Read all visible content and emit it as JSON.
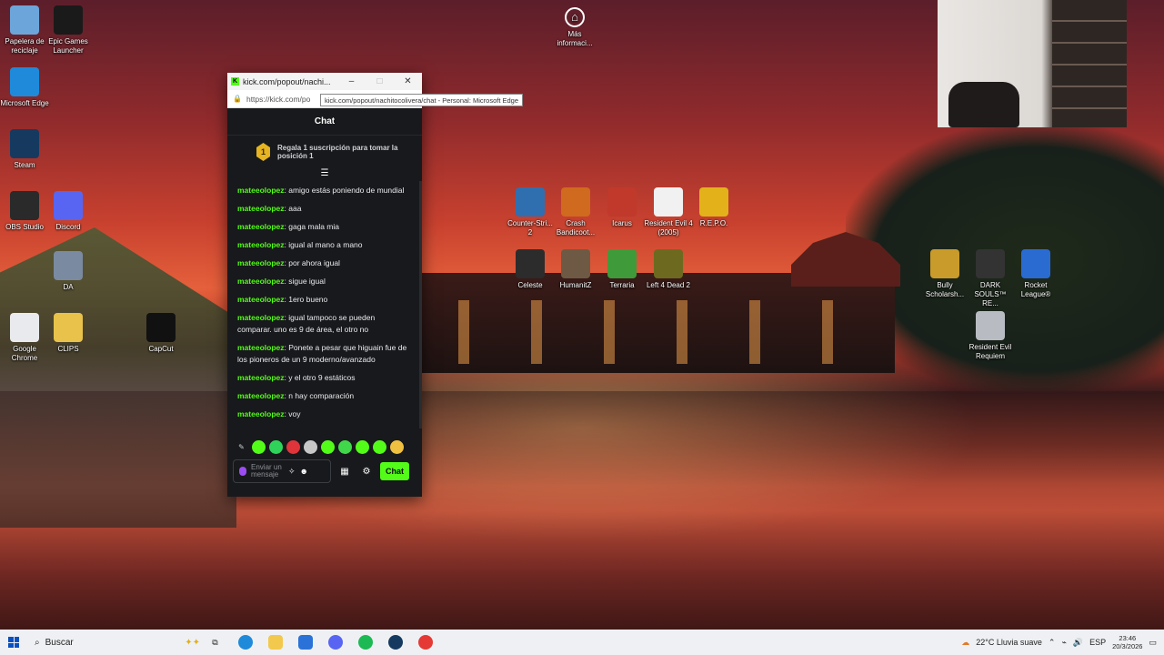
{
  "desktop": {
    "left_icons": [
      {
        "label": "Papelera de reciclaje",
        "icon": "recycle-bin-icon",
        "color": "#6ca5d9"
      },
      {
        "label": "Epic Games Launcher",
        "icon": "epic-games-icon",
        "color": "#1a1a1a"
      },
      {
        "label": "Microsoft Edge",
        "icon": "edge-icon",
        "color": "#1f8ad9"
      },
      {
        "label": "Steam",
        "icon": "steam-icon",
        "color": "#163a5f"
      },
      {
        "label": "OBS Studio",
        "icon": "obs-icon",
        "color": "#2a2a2a"
      },
      {
        "label": "Discord",
        "icon": "discord-icon",
        "color": "#5865f2"
      },
      {
        "label": "DA",
        "icon": "da-shortcut-icon",
        "color": "#7a8aa0"
      },
      {
        "label": "Google Chrome",
        "icon": "chrome-icon",
        "color": "#e8eaed"
      },
      {
        "label": "CLIPS",
        "icon": "folder-icon",
        "color": "#e8c24a"
      },
      {
        "label": "CapCut",
        "icon": "capcut-icon",
        "color": "#111111"
      }
    ],
    "info_icon": {
      "label": "Más informaci...",
      "icon": "info-camera-icon"
    },
    "game_icons": [
      {
        "label": "Counter-Stri... 2",
        "icon": "cs2-icon",
        "color": "#2f6fb0"
      },
      {
        "label": "Crash Bandicoot...",
        "icon": "crash-icon",
        "color": "#d06a1e"
      },
      {
        "label": "Icarus",
        "icon": "icarus-icon",
        "color": "#c0392b"
      },
      {
        "label": "Resident Evil 4 (2005)",
        "icon": "re4-icon",
        "color": "#f1f1f1"
      },
      {
        "label": "R.E.P.O.",
        "icon": "repo-icon",
        "color": "#e3b21a"
      },
      {
        "label": "Celeste",
        "icon": "celeste-icon",
        "color": "#2c2c2c"
      },
      {
        "label": "HumanitZ",
        "icon": "humanitz-icon",
        "color": "#6e5a44"
      },
      {
        "label": "Terraria",
        "icon": "terraria-icon",
        "color": "#3f9a3a"
      },
      {
        "label": "Left 4 Dead 2",
        "icon": "l4d2-icon",
        "color": "#6d6a1f"
      }
    ],
    "right_icons": [
      {
        "label": "Bully Scholarsh...",
        "icon": "bully-icon",
        "color": "#c99b2a"
      },
      {
        "label": "DARK SOULS™ RE...",
        "icon": "darksouls-icon",
        "color": "#333333"
      },
      {
        "label": "Rocket League®",
        "icon": "rocket-league-icon",
        "color": "#2a6bd1"
      },
      {
        "label": "Resident Evil Requiem",
        "icon": "re-requiem-icon",
        "color": "#b8bcc2"
      }
    ]
  },
  "popout": {
    "title": "kick.com/popout/nachi...",
    "url": "https://kick.com/po",
    "tooltip": "kick.com/popout/nachitocolivera/chat - Personal: Microsoft Edge",
    "header": "Chat",
    "gift_badge": "1",
    "gift_text": "Regala 1 suscripción para tomar la posición 1",
    "messages": [
      {
        "user": "mateeolopez",
        "text": "amigo estás poniendo de mundial"
      },
      {
        "user": "mateeolopez",
        "text": "aaa"
      },
      {
        "user": "mateeolopez",
        "text": "gaga mala mia"
      },
      {
        "user": "mateeolopez",
        "text": "igual al mano a mano"
      },
      {
        "user": "mateeolopez",
        "text": "por ahora igual"
      },
      {
        "user": "mateeolopez",
        "text": "sigue igual"
      },
      {
        "user": "mateeolopez",
        "text": "1ero bueno"
      },
      {
        "user": "mateeolopez",
        "text": "igual tampoco se pueden comparar. uno es 9 de área, el otro no"
      },
      {
        "user": "mateeolopez",
        "text": "Ponete a pesar que higuain fue de los pioneros de un 9 moderno/avanzado"
      },
      {
        "user": "mateeolopez",
        "text": "y el otro 9 estáticos"
      },
      {
        "user": "mateeolopez",
        "text": "n hay comparación"
      },
      {
        "user": "mateeolopez",
        "text": "voy"
      }
    ],
    "input_placeholder": "Enviar un mensaje",
    "send_label": "Chat",
    "accent": "#53fc18"
  },
  "taskbar": {
    "search_label": "Buscar",
    "weather": "22°C  Lluvia suave",
    "lang": "ESP",
    "time": "23:46",
    "date": "20/3/2026"
  }
}
